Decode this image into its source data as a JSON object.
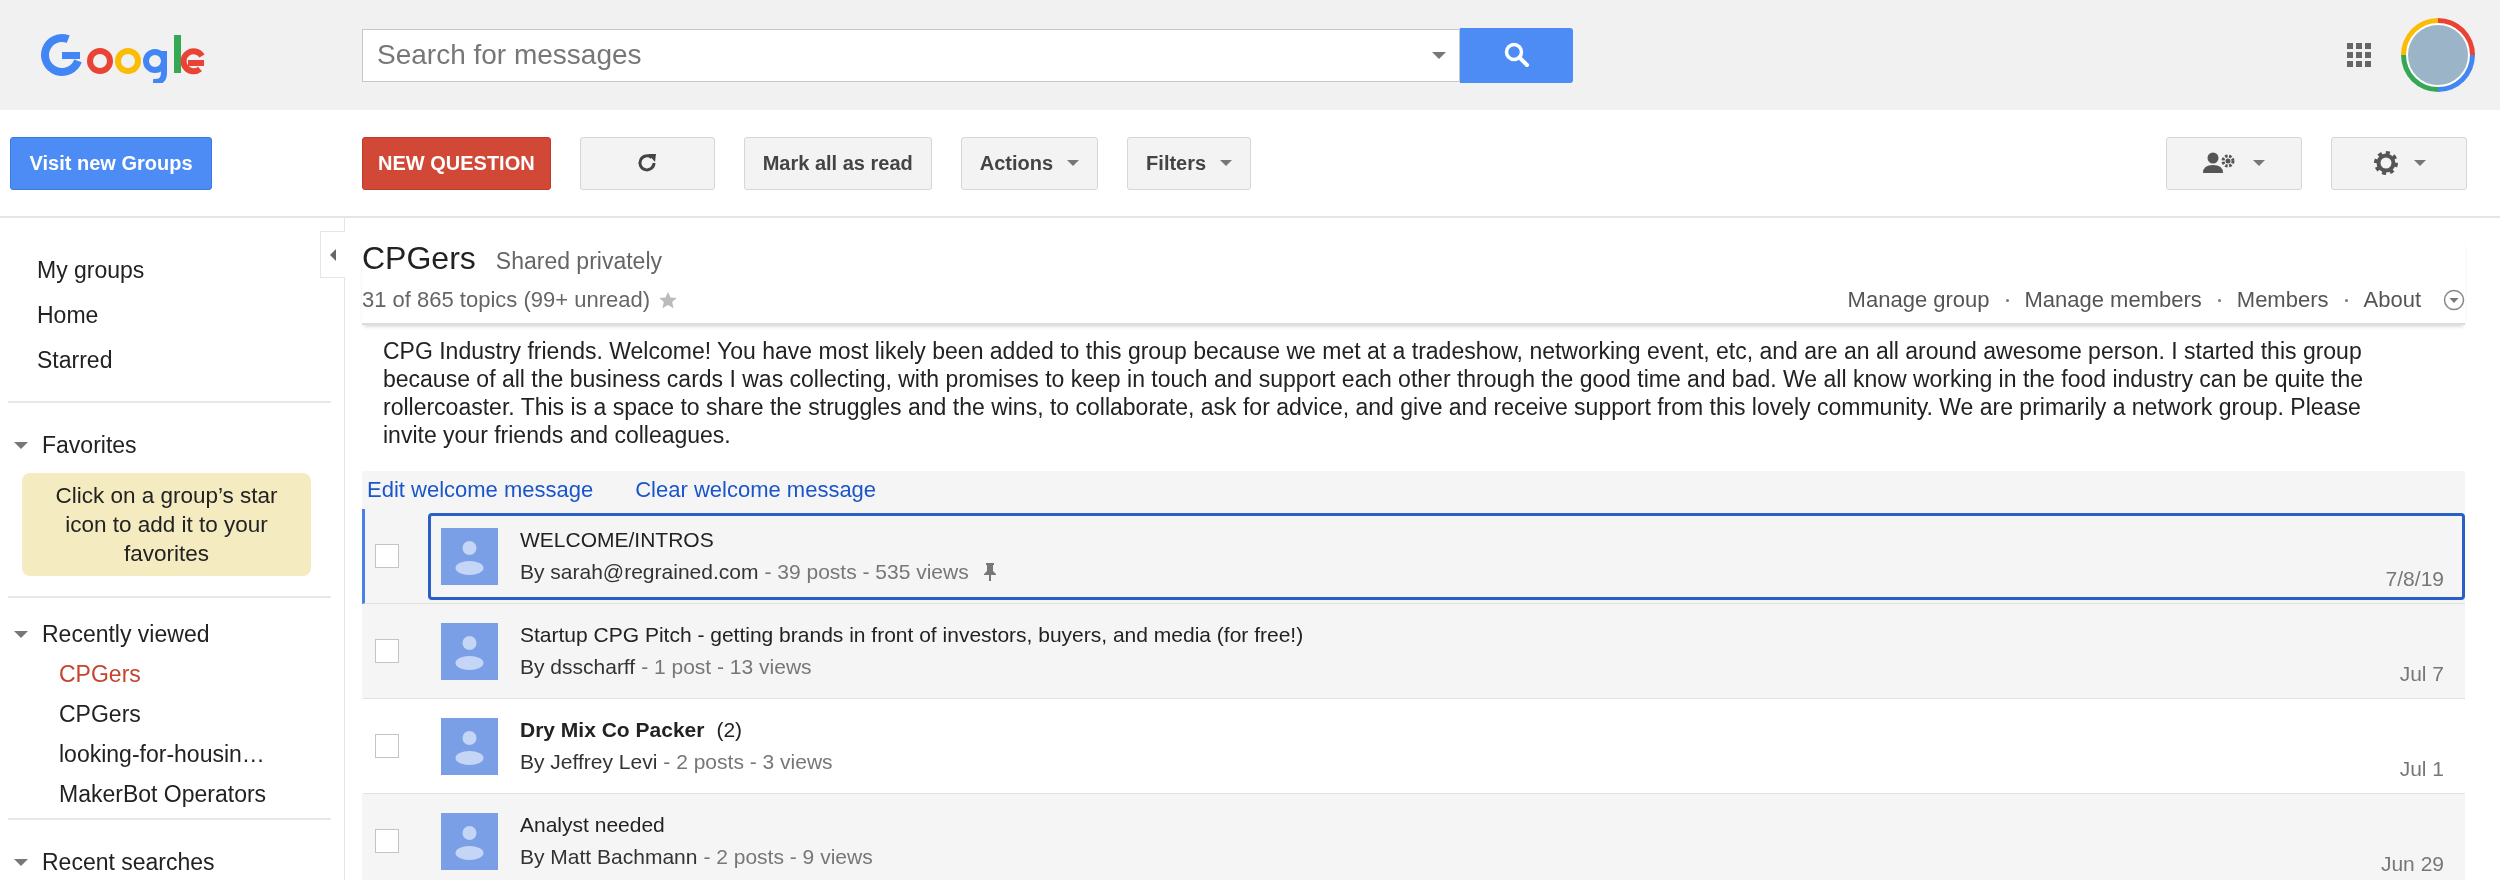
{
  "header": {
    "search": {
      "placeholder": "Search for messages"
    }
  },
  "toolbar": {
    "left_button": {
      "label": "Visit new Groups"
    },
    "buttons": [
      {
        "kind": "accent",
        "label": "NEW QUESTION"
      },
      {
        "kind": "refresh"
      },
      {
        "kind": "plain",
        "label": "Mark all as read"
      },
      {
        "kind": "menu",
        "label": "Actions"
      },
      {
        "kind": "menu",
        "label": "Filters"
      }
    ],
    "right_buttons": [
      {
        "kind": "people"
      },
      {
        "kind": "gear"
      }
    ]
  },
  "sidebar": {
    "nav": [
      {
        "label": "My groups"
      },
      {
        "label": "Home"
      },
      {
        "label": "Starred"
      }
    ],
    "sections": [
      {
        "title": "Favorites",
        "expanded": true,
        "note": "Click on a group’s star icon to add it to your favorites"
      },
      {
        "title": "Recently viewed",
        "expanded": true,
        "items": [
          {
            "label": "CPGers",
            "selected": true
          },
          {
            "label": "CPGers",
            "selected": false
          },
          {
            "label": "looking-for-housin…",
            "selected": false
          },
          {
            "label": "MakerBot Operators",
            "selected": false
          }
        ]
      },
      {
        "title": "Recent searches",
        "expanded": true
      }
    ]
  },
  "group": {
    "name": "CPGers",
    "sharing": "Shared privately",
    "summary": "31 of 865 topics (99+ unread)",
    "starred": false,
    "links": [
      "Manage group",
      "Manage members",
      "Members",
      "About"
    ],
    "welcome": "CPG Industry friends. Welcome! You have most likely been added to this group because we met at a tradeshow, networking event, etc, and are an all around awesome person. I started this group because of all the business cards I was collecting, with promises to keep in touch and support each other through the good time and bad. We all know working in the food industry can be quite the rollercoaster. This is a space to share the struggles and the wins, to collaborate, ask for advice, and give and receive support from this lovely community. We are primarily a network group. Please invite your friends and colleagues.",
    "welcome_actions": [
      "Edit welcome message",
      "Clear welcome message"
    ]
  },
  "topics": [
    {
      "title": "WELCOME/INTROS",
      "author": "By sarah@regrained.com",
      "stats": "- 39 posts - 535 views",
      "date": "7/8/19",
      "pinned": true,
      "unread": false,
      "selected": true,
      "checked": false
    },
    {
      "title": "Startup CPG Pitch - getting brands in front of investors, buyers, and media (for free!)",
      "author": "By dsscharff",
      "stats": "- 1 post - 13 views",
      "date": "Jul 7",
      "pinned": false,
      "unread": false,
      "selected": false,
      "checked": false
    },
    {
      "title": "Dry Mix Co Packer",
      "count": "(2)",
      "author": "By Jeffrey Levi",
      "stats": "- 2 posts - 3 views",
      "date": "Jul 1",
      "pinned": false,
      "unread": true,
      "selected": false,
      "checked": false
    },
    {
      "title": "Analyst needed",
      "author": "By Matt Bachmann",
      "stats": "- 2 posts - 9 views",
      "date": "Jun 29",
      "pinned": false,
      "unread": false,
      "selected": false,
      "checked": false
    }
  ]
}
